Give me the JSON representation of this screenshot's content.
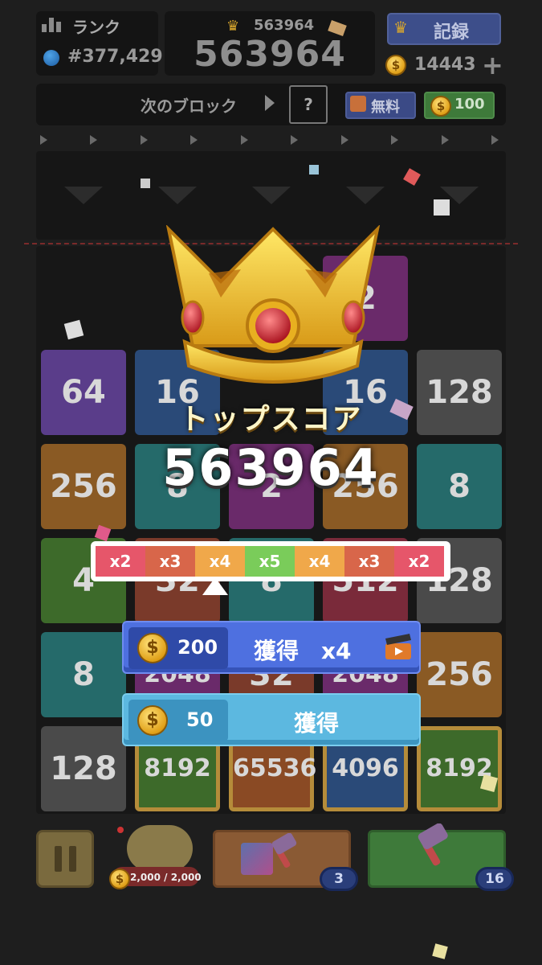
{
  "header": {
    "rank_label": "ランク",
    "rank_value": "#377,429",
    "best_score": "563964",
    "current_score": "563964",
    "record_label": "記録",
    "coins": "14443",
    "plus": "+"
  },
  "next_block": {
    "label": "次のブロック",
    "preview": "?",
    "free_label": "無料",
    "price": "100"
  },
  "board": {
    "tiles": [
      {
        "value": "64",
        "color": "#5a3d8a",
        "col": 1,
        "row": 2
      },
      {
        "value": "16",
        "color": "#2a4a78",
        "col": 2,
        "row": 2
      },
      {
        "value": "16",
        "color": "#2a4a78",
        "col": 4,
        "row": 2
      },
      {
        "value": "128",
        "color": "#4a4a4a",
        "col": 5,
        "row": 2
      },
      {
        "value": "256",
        "color": "#8a5a24",
        "col": 1,
        "row": 3
      },
      {
        "value": "8",
        "color": "#256a6a",
        "col": 2,
        "row": 3
      },
      {
        "value": "2",
        "color": "#6a2a6a",
        "col": 3,
        "row": 3
      },
      {
        "value": "256",
        "color": "#8a5a24",
        "col": 4,
        "row": 3
      },
      {
        "value": "8",
        "color": "#256a6a",
        "col": 5,
        "row": 3
      },
      {
        "value": "4",
        "color": "#3d6a2a",
        "col": 1,
        "row": 4
      },
      {
        "value": "32",
        "color": "#7a3a2a",
        "col": 2,
        "row": 4
      },
      {
        "value": "8",
        "color": "#256a6a",
        "col": 3,
        "row": 4
      },
      {
        "value": "512",
        "color": "#7a2a3a",
        "col": 4,
        "row": 4
      },
      {
        "value": "128",
        "color": "#4a4a4a",
        "col": 5,
        "row": 4
      },
      {
        "value": "8",
        "color": "#256a6a",
        "col": 1,
        "row": 5
      },
      {
        "value": "2048",
        "color": "#6a2a6a",
        "col": 2,
        "row": 5
      },
      {
        "value": "32",
        "color": "#7a3a2a",
        "col": 3,
        "row": 5
      },
      {
        "value": "2048",
        "color": "#6a2a6a",
        "col": 4,
        "row": 5
      },
      {
        "value": "256",
        "color": "#8a5a24",
        "col": 5,
        "row": 5
      },
      {
        "value": "128",
        "color": "#4a4a4a",
        "col": 1,
        "row": 6
      },
      {
        "value": "8192",
        "color": "#3d6a2a",
        "col": 2,
        "row": 6
      },
      {
        "value": "65536",
        "color": "#8a4a24",
        "col": 3,
        "row": 6
      },
      {
        "value": "4096",
        "color": "#2a4a78",
        "col": 4,
        "row": 6
      },
      {
        "value": "8192",
        "color": "#3d6a2a",
        "col": 5,
        "row": 6
      },
      {
        "value": "2",
        "color": "#6a2a6a",
        "col": 4,
        "row": 1
      }
    ]
  },
  "overlay": {
    "title": "トップスコア",
    "score": "563964",
    "multipliers": [
      {
        "label": "x2",
        "color": "#e6566a"
      },
      {
        "label": "x3",
        "color": "#d8664a"
      },
      {
        "label": "x4",
        "color": "#f0a84a"
      },
      {
        "label": "x5",
        "color": "#7acc5a"
      },
      {
        "label": "x4",
        "color": "#f0a84a"
      },
      {
        "label": "x3",
        "color": "#d8664a"
      },
      {
        "label": "x2",
        "color": "#e6566a"
      }
    ],
    "claim_ad": {
      "amount": "200",
      "label": "獲得　x4"
    },
    "claim_basic": {
      "amount": "50",
      "label": "獲得"
    }
  },
  "bottom": {
    "piggy": "2,000 / 2,000",
    "hammer1_count": "3",
    "hammer2_count": "16"
  },
  "colors": {
    "background": "#1e1e1e",
    "crown_gold": "#f2c430",
    "ad_button": "#4e70e0",
    "basic_button": "#5cb8e0"
  }
}
